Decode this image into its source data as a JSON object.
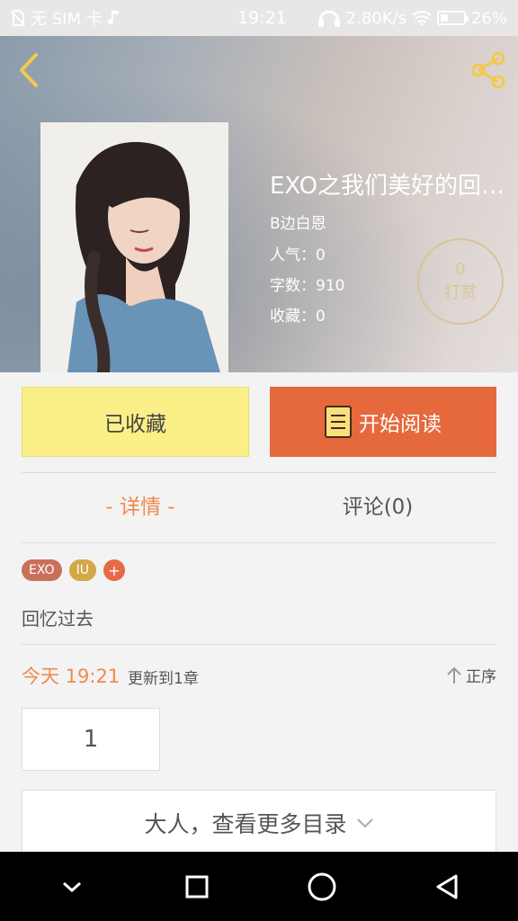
{
  "status_bar": {
    "sim_text": "无 SIM 卡",
    "time": "19:21",
    "network_speed": "2.80K/s",
    "battery": "26%"
  },
  "header": {
    "back_icon": "chevron-left-icon",
    "share_icon": "share-icon"
  },
  "book": {
    "title": "EXO之我们美好的回…",
    "author": "B边白恩",
    "popularity": "人气：0",
    "word_count": "字数：910",
    "favorites": "收藏：0",
    "reward_count": "0",
    "reward_label": "打赏"
  },
  "actions": {
    "favorite_label": "已收藏",
    "read_label": "开始阅读"
  },
  "tabs": {
    "details": "- 详情 -",
    "comments": "评论(0)"
  },
  "tags": [
    "EXO",
    "IU",
    "+"
  ],
  "summary": "回忆过去",
  "update": {
    "time": "今天 19:21",
    "text": "更新到1章",
    "order_label": "正序"
  },
  "chapters": [
    "1"
  ],
  "more_catalog": "大人，查看更多目录",
  "colors": {
    "accent_orange": "#e6693d",
    "favorite_yellow": "#fbef88",
    "reward_gold": "#d9c496"
  }
}
